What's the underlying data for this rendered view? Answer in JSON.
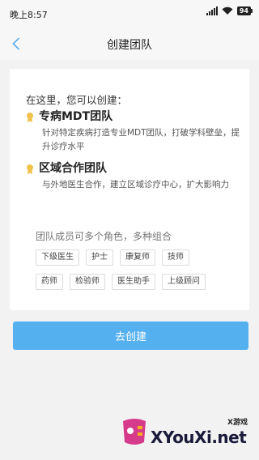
{
  "status": {
    "time": "晚上8:57",
    "battery": "94"
  },
  "nav": {
    "title": "创建团队"
  },
  "intro": "在这里，您可以创建：",
  "teams": [
    {
      "title": "专病MDT团队",
      "desc": "针对特定疾病打造专业MDT团队，打破学科壁垒，提升诊疗水平"
    },
    {
      "title": "区域合作团队",
      "desc": "与外地医生合作，建立区域诊疗中心，扩大影响力"
    }
  ],
  "roles": {
    "heading": "团队成员可多个角色，多种组合",
    "row1": [
      "下级医生",
      "护士",
      "康复师",
      "技师"
    ],
    "row2": [
      "药师",
      "检验师",
      "医生助手",
      "上级顾问"
    ]
  },
  "create_button": "去创建",
  "watermark": {
    "cn": "X游戏",
    "en": "XYouXi.net"
  },
  "colors": {
    "accent": "#55b0f0",
    "medal": "#f0c24a"
  }
}
